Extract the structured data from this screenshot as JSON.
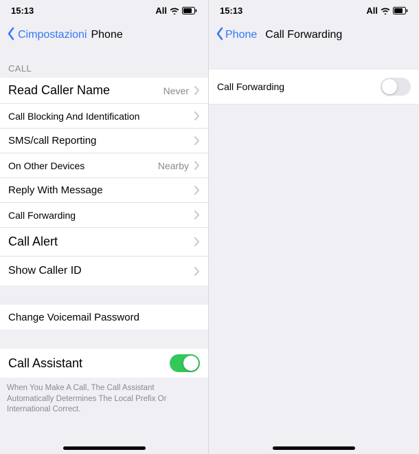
{
  "statusBar": {
    "time": "15:13",
    "carrier": "All"
  },
  "left": {
    "nav": {
      "back": "Cimpostazioni",
      "title": "Phone"
    },
    "sectionHeader": "CALL",
    "rows": {
      "readCallerName": {
        "label": "Read Caller Name",
        "value": "Never"
      },
      "callBlocking": {
        "label": "Call Blocking And Identification"
      },
      "smsReporting": {
        "label": "SMS/call Reporting"
      },
      "otherDevices": {
        "label": "On Other Devices",
        "value": "Nearby"
      },
      "replyMessage": {
        "label": "Reply With Message"
      },
      "callForwarding": {
        "label": "Call Forwarding"
      },
      "callAlert": {
        "label": "Call Alert"
      },
      "showCallerId": {
        "label": "Show Caller ID"
      },
      "voicemailPw": {
        "label": "Change Voicemail Password"
      },
      "callAssistant": {
        "label": "Call Assistant",
        "on": true
      }
    },
    "footer": "When You Make A Call, The Call Assistant Automatically Determines The Local Prefix Or International Correct."
  },
  "right": {
    "nav": {
      "back": "Phone",
      "title": "Call Forwarding"
    },
    "rowLabel": "Call Forwarding",
    "toggleOn": false
  }
}
